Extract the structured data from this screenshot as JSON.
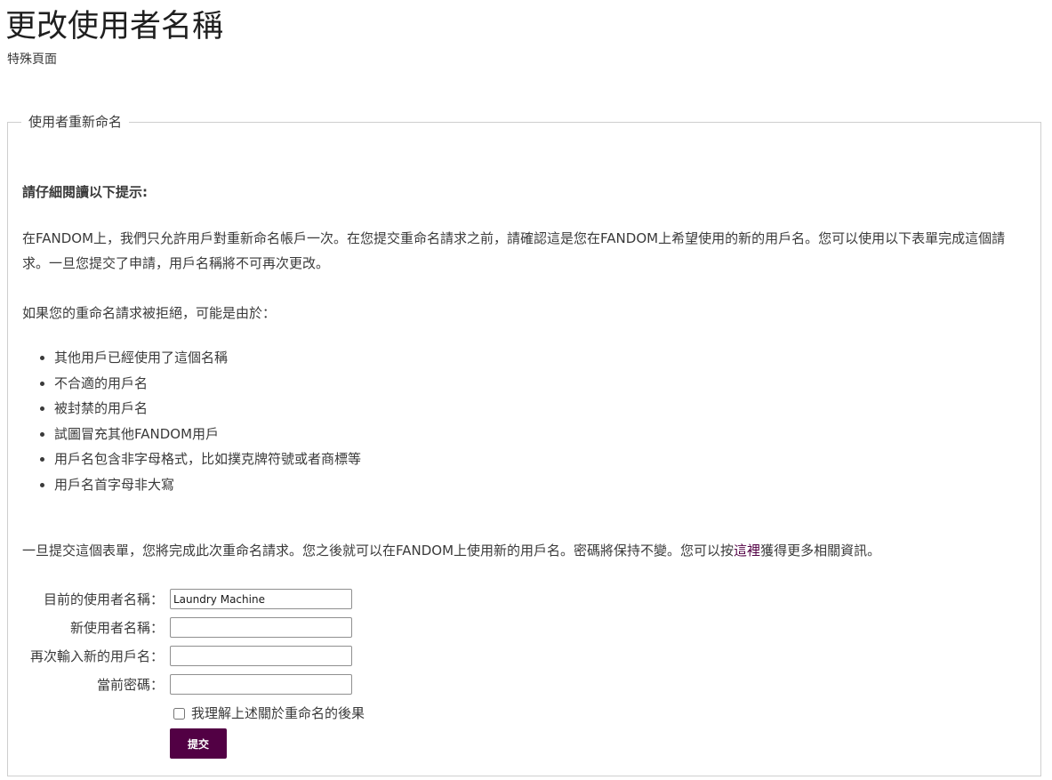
{
  "header": {
    "title": "更改使用者名稱",
    "subtitle": "特殊頁面"
  },
  "form_box": {
    "legend": "使用者重新命名",
    "notice_heading": "請仔細閱讀以下提示:",
    "paragraph_1": "在FANDOM上，我們只允許用戶對重新命名帳戶一次。在您提交重命名請求之前，請確認這是您在FANDOM上希望使用的新的用戶名。您可以使用以下表單完成這個請求。一旦您提交了申請，用戶名稱將不可再次更改。",
    "paragraph_2": "如果您的重命名請求被拒絕，可能是由於：",
    "reasons": [
      "其他用戶已經使用了這個名稱",
      "不合適的用戶名",
      "被封禁的用戶名",
      "試圖冒充其他FANDOM用戶",
      "用戶名包含非字母格式，比如撲克牌符號或者商標等",
      "用戶名首字母非大寫"
    ],
    "paragraph_3_before": "一旦提交這個表單，您將完成此次重命名請求。您之後就可以在FANDOM上使用新的用戶名。密碼將保持不變。您可以按",
    "paragraph_3_link": "這裡",
    "paragraph_3_after": "獲得更多相關資訊。"
  },
  "fields": {
    "current_name_label": "目前的使用者名稱：",
    "current_name_value": "Laundry Machine",
    "new_name_label": "新使用者名稱：",
    "new_name_value": "",
    "repeat_name_label": "再次輸入新的用戶名：",
    "repeat_name_value": "",
    "password_label": "當前密碼：",
    "password_value": ""
  },
  "consent": {
    "label": "我理解上述關於重命名的後果",
    "checked": false
  },
  "actions": {
    "submit_label": "提交"
  },
  "colors": {
    "accent": "#520044",
    "text": "#3a3a3a",
    "border": "#cfcfcf"
  }
}
